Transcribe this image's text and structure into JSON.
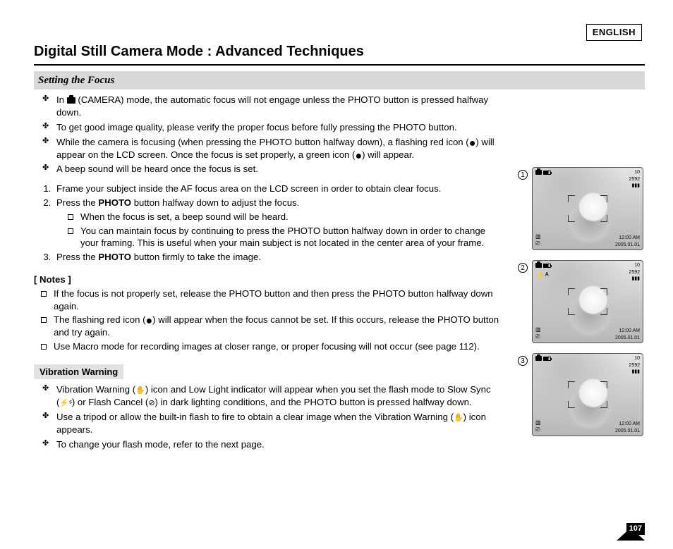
{
  "language": "ENGLISH",
  "title": "Digital Still Camera Mode : Advanced Techniques",
  "section": "Setting the Focus",
  "bullets_top": {
    "b1a": "In ",
    "b1b": " (CAMERA) mode, the automatic focus will not engage unless the PHOTO button is pressed halfway down.",
    "b2": "To get good image quality, please verify the proper focus before fully pressing the PHOTO button.",
    "b3a": "While the camera is focusing (when pressing the PHOTO button halfway down), a flashing red icon (",
    "b3b": ") will appear on the LCD screen. Once the focus is set properly, a green icon (",
    "b3c": ") will appear.",
    "b4": "A beep sound will be heard once the focus is set."
  },
  "steps": {
    "s1": "Frame your subject inside the AF focus area on the LCD screen in order to obtain clear focus.",
    "s2a": "Press the ",
    "s2b": " button halfway down to adjust the focus.",
    "s2sub1": "When the focus is set, a beep sound will be heard.",
    "s2sub2": "You can maintain focus by continuing to press the PHOTO button halfway down in order to change your framing. This is useful when your main subject is not located in the center area of your frame.",
    "s3a": "Press the ",
    "s3b": " button firmly to take the image."
  },
  "photo_label": "PHOTO",
  "notes_heading": "[ Notes ]",
  "notes": {
    "n1": "If the focus is not properly set, release the PHOTO button and then press the PHOTO button halfway down again.",
    "n2a": "The flashing red icon (",
    "n2b": ")  will appear when the focus cannot be set. If this occurs, release the PHOTO button and try again.",
    "n3": "Use Macro mode for recording images at closer range, or proper focusing will not occur (see page 112)."
  },
  "vibration_heading": "Vibration Warning",
  "vibration": {
    "v1a": "Vibration Warning (",
    "v1b": ") icon and Low Light indicator will appear when you set the flash mode to Slow Sync (",
    "v1c": ") or Flash Cancel (",
    "v1d": ") in dark lighting conditions, and the PHOTO button is pressed halfway down.",
    "v2a": "Use a tripod or allow the built-in flash to fire to obtain a clear image when the Vibration Warning (",
    "v2b": ") icon appears.",
    "v3": "To change your flash mode, refer to the next page."
  },
  "thumbs": {
    "count": "10",
    "res": "2592",
    "time": "12:00 AM",
    "date": "2005.01.01"
  },
  "icons": {
    "slow_sync": "⚡ˢ",
    "flash_cancel": "⊘"
  },
  "page_number": "107"
}
